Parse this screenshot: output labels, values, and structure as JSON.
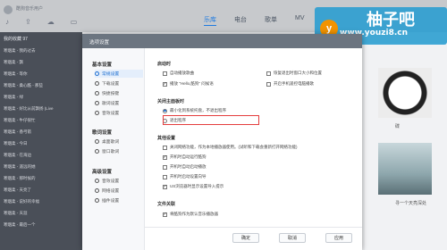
{
  "app": {
    "user_name": "酷狗音乐用户",
    "left_header": "我的收藏  97",
    "tabs": [
      "乐库",
      "电台",
      "歌单",
      "MV"
    ],
    "songs": [
      "寒烟柔 - 我的过去",
      "寒烟柔 - 飘",
      "寒烟柔 - 等你",
      "寒烟柔 - 桑心酷 - 那些",
      "寒烟柔 - 绿",
      "寒烟柔 - 好比从前飘扬 (Live",
      "寒烟柔 - 牛仔很忙",
      "寒烟柔 - 香弓箭",
      "寒烟柔 - 今日",
      "寒烟柔 - 在海边",
      "寒烟柔 - 遥远的她",
      "寒烟柔 - 那时候的",
      "寒烟柔 - 天亮了",
      "寒烟柔 - 说好的幸福",
      "寒烟柔 - 天涯",
      "寒烟柔 - 最后一个"
    ],
    "right_songs": [
      "碟",
      "寻一个天亮深处",
      "汪晨蔚"
    ]
  },
  "watermark": {
    "logo_char": "y",
    "logo_text": "柚子吧",
    "logo_url": "www.youzi8.cn"
  },
  "dialog": {
    "title": "选项设置",
    "sidebar": {
      "sections": [
        {
          "label": "基本设置",
          "items": [
            "常规设置",
            "下载设置",
            "快捷按键",
            "歌词设置",
            "音效设置"
          ]
        },
        {
          "label": "歌词设置",
          "items": [
            "桌面歌词",
            "窗口歌词"
          ]
        },
        {
          "label": "高级设置",
          "items": [
            "音效设置",
            "网络设置",
            "插件设置"
          ]
        }
      ]
    },
    "content": {
      "startup": {
        "title": "启动时",
        "opts": [
          {
            "label": "自动播放歌曲",
            "checked": false
          },
          {
            "label": "播放 \"Hello,酷狗\" 问候语",
            "checked": true
          },
          {
            "label": "恢复退出时窗口大小和位置",
            "checked": false
          },
          {
            "label": "开启手机遥控电脑播歌",
            "checked": false
          }
        ]
      },
      "close": {
        "title": "关闭主面板时",
        "opts": [
          {
            "label": "最小化到系统托盘，不退出程序",
            "checked": true
          },
          {
            "label": "退出程序",
            "checked": false
          }
        ]
      },
      "other": {
        "title": "其他设置",
        "opts": [
          {
            "label": "关闭网络功能，作为本地播放器使用。(试听和下载会重新打开网络功能)",
            "checked": false
          },
          {
            "label": "开机时自动运行酷狗",
            "checked": true
          },
          {
            "label": "开机时自动启动播放",
            "checked": false
          },
          {
            "label": "开机时启动设置向导",
            "checked": false
          },
          {
            "label": "US浏览器时显示设置导入提示",
            "checked": true
          }
        ]
      },
      "file_assoc": {
        "title": "文件关联",
        "opts": [
          {
            "label": "将酷狗作为默认音乐播放器",
            "checked": true
          }
        ]
      }
    },
    "footer": {
      "ok": "确定",
      "cancel": "取消",
      "apply": "应用"
    }
  }
}
